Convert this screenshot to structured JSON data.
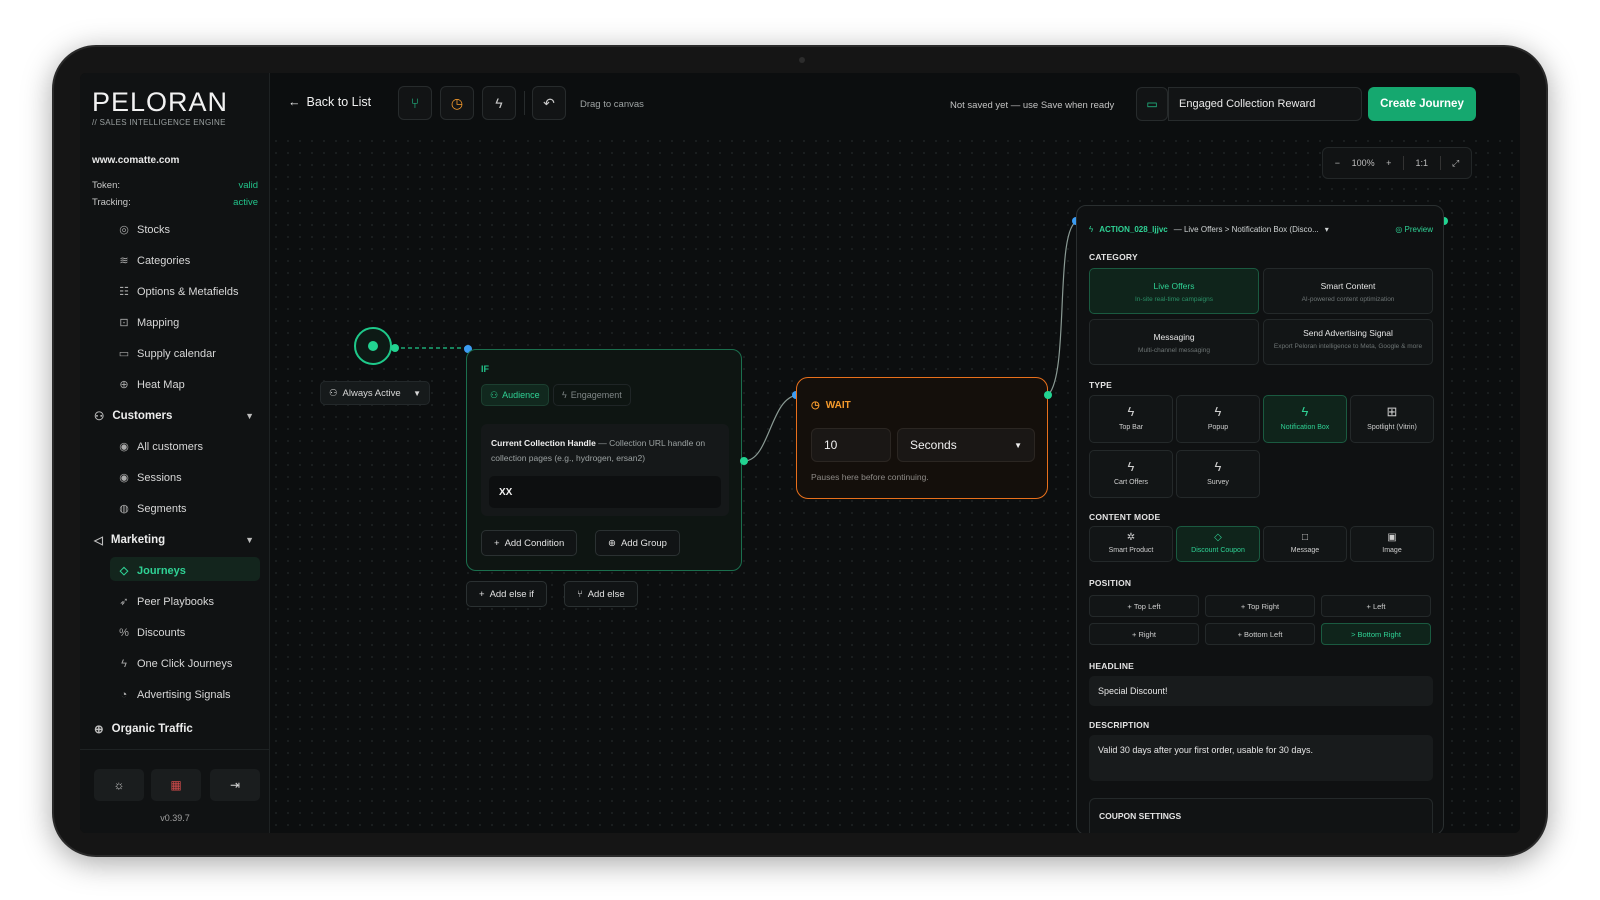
{
  "brand": {
    "name": "PELORAN",
    "tagline": "// SALES INTELLIGENCE ENGINE"
  },
  "site": {
    "domain": "www.comatte.com",
    "token_label": "Token:",
    "token_value": "valid",
    "tracking_label": "Tracking:",
    "tracking_value": "active"
  },
  "sidebar": {
    "catalog_items": [
      "Stocks",
      "Categories",
      "Options & Metafields",
      "Mapping",
      "Supply calendar",
      "Heat Map"
    ],
    "customers": {
      "label": "Customers",
      "items": [
        "All customers",
        "Sessions",
        "Segments"
      ]
    },
    "marketing": {
      "label": "Marketing",
      "items": [
        "Journeys",
        "Peer Playbooks",
        "Discounts",
        "One Click Journeys",
        "Advertising Signals"
      ]
    },
    "organic": {
      "label": "Organic Traffic"
    },
    "version": "v0.39.7",
    "colors": {
      "accent": "#22c38a",
      "active_bg": "#13251d"
    }
  },
  "toolbar": {
    "back_label": "Back to List",
    "drag_hint": "Drag to canvas",
    "save_status": "Not saved yet — use Save when ready",
    "journey_name": "Engaged Collection Reward",
    "create_label": "Create Journey"
  },
  "zoom": {
    "level": "100%",
    "reset": "1:1"
  },
  "trigger": {
    "label": "Always Active"
  },
  "if_node": {
    "title": "IF",
    "tab_active": "Audience",
    "tab_inactive": "Engagement",
    "condition_name": "Current Collection Handle",
    "condition_desc": " — Collection URL handle on collection pages (e.g., hydrogen, ersan2)",
    "condition_value": "XX",
    "add_condition": "Add Condition",
    "add_group": "Add Group",
    "add_else_if": "Add else if",
    "add_else": "Add else"
  },
  "wait_node": {
    "title": "WAIT",
    "amount": "10",
    "unit": "Seconds",
    "note": "Pauses here before continuing.",
    "color": "#e8701c"
  },
  "action_panel": {
    "action_id": "ACTION_028_ljjvc",
    "breadcrumb": " — Live Offers > Notification Box (Disco...",
    "preview": "Preview",
    "category_label": "CATEGORY",
    "categories": [
      {
        "title": "Live Offers",
        "sub": "In-site real-time campaigns"
      },
      {
        "title": "Smart Content",
        "sub": "AI-powered content optimization"
      },
      {
        "title": "Messaging",
        "sub": "Multi-channel messaging"
      },
      {
        "title": "Send Advertising Signal",
        "sub": "Export Peloran intelligence to Meta, Google & more"
      }
    ],
    "type_label": "TYPE",
    "types": [
      "Top Bar",
      "Popup",
      "Notification Box",
      "Spotlight (Vitrin)",
      "Cart Offers",
      "Survey"
    ],
    "content_mode_label": "CONTENT MODE",
    "content_modes": [
      "Smart Product",
      "Discount Coupon",
      "Message",
      "Image"
    ],
    "position_label": "POSITION",
    "positions": [
      "Top Left",
      "Top Right",
      "Left",
      "Right",
      "Bottom Left",
      "Bottom Right"
    ],
    "headline_label": "HEADLINE",
    "headline_value": "Special Discount!",
    "description_label": "DESCRIPTION",
    "description_value": "Valid 30 days after your first order, usable for 30 days.",
    "coupon_label": "COUPON SETTINGS"
  }
}
